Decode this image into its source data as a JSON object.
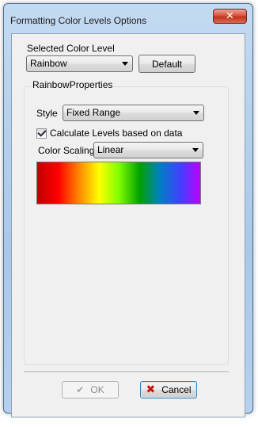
{
  "window": {
    "title": "Formatting Color Levels Options",
    "close_label": "✕"
  },
  "selected_color_level": {
    "label": "Selected Color Level",
    "value": "Rainbow",
    "default_button": "Default"
  },
  "properties": {
    "group_title": "RainbowProperties",
    "style_label": "Style",
    "style_value": "Fixed Range",
    "calculate_label": "Calculate Levels based on data",
    "calculate_checked": true,
    "scaling_label": "Color Scaling",
    "scaling_value": "Linear",
    "gradient_colors": [
      "#c00000",
      "#ff0000",
      "#ff8000",
      "#ffff00",
      "#80ff00",
      "#00a000",
      "#0080c0",
      "#4040ff",
      "#c000ff"
    ]
  },
  "footer": {
    "ok_label": "OK",
    "ok_icon": "checkmark-icon",
    "cancel_label": "Cancel",
    "cancel_icon": "red-x-icon"
  }
}
